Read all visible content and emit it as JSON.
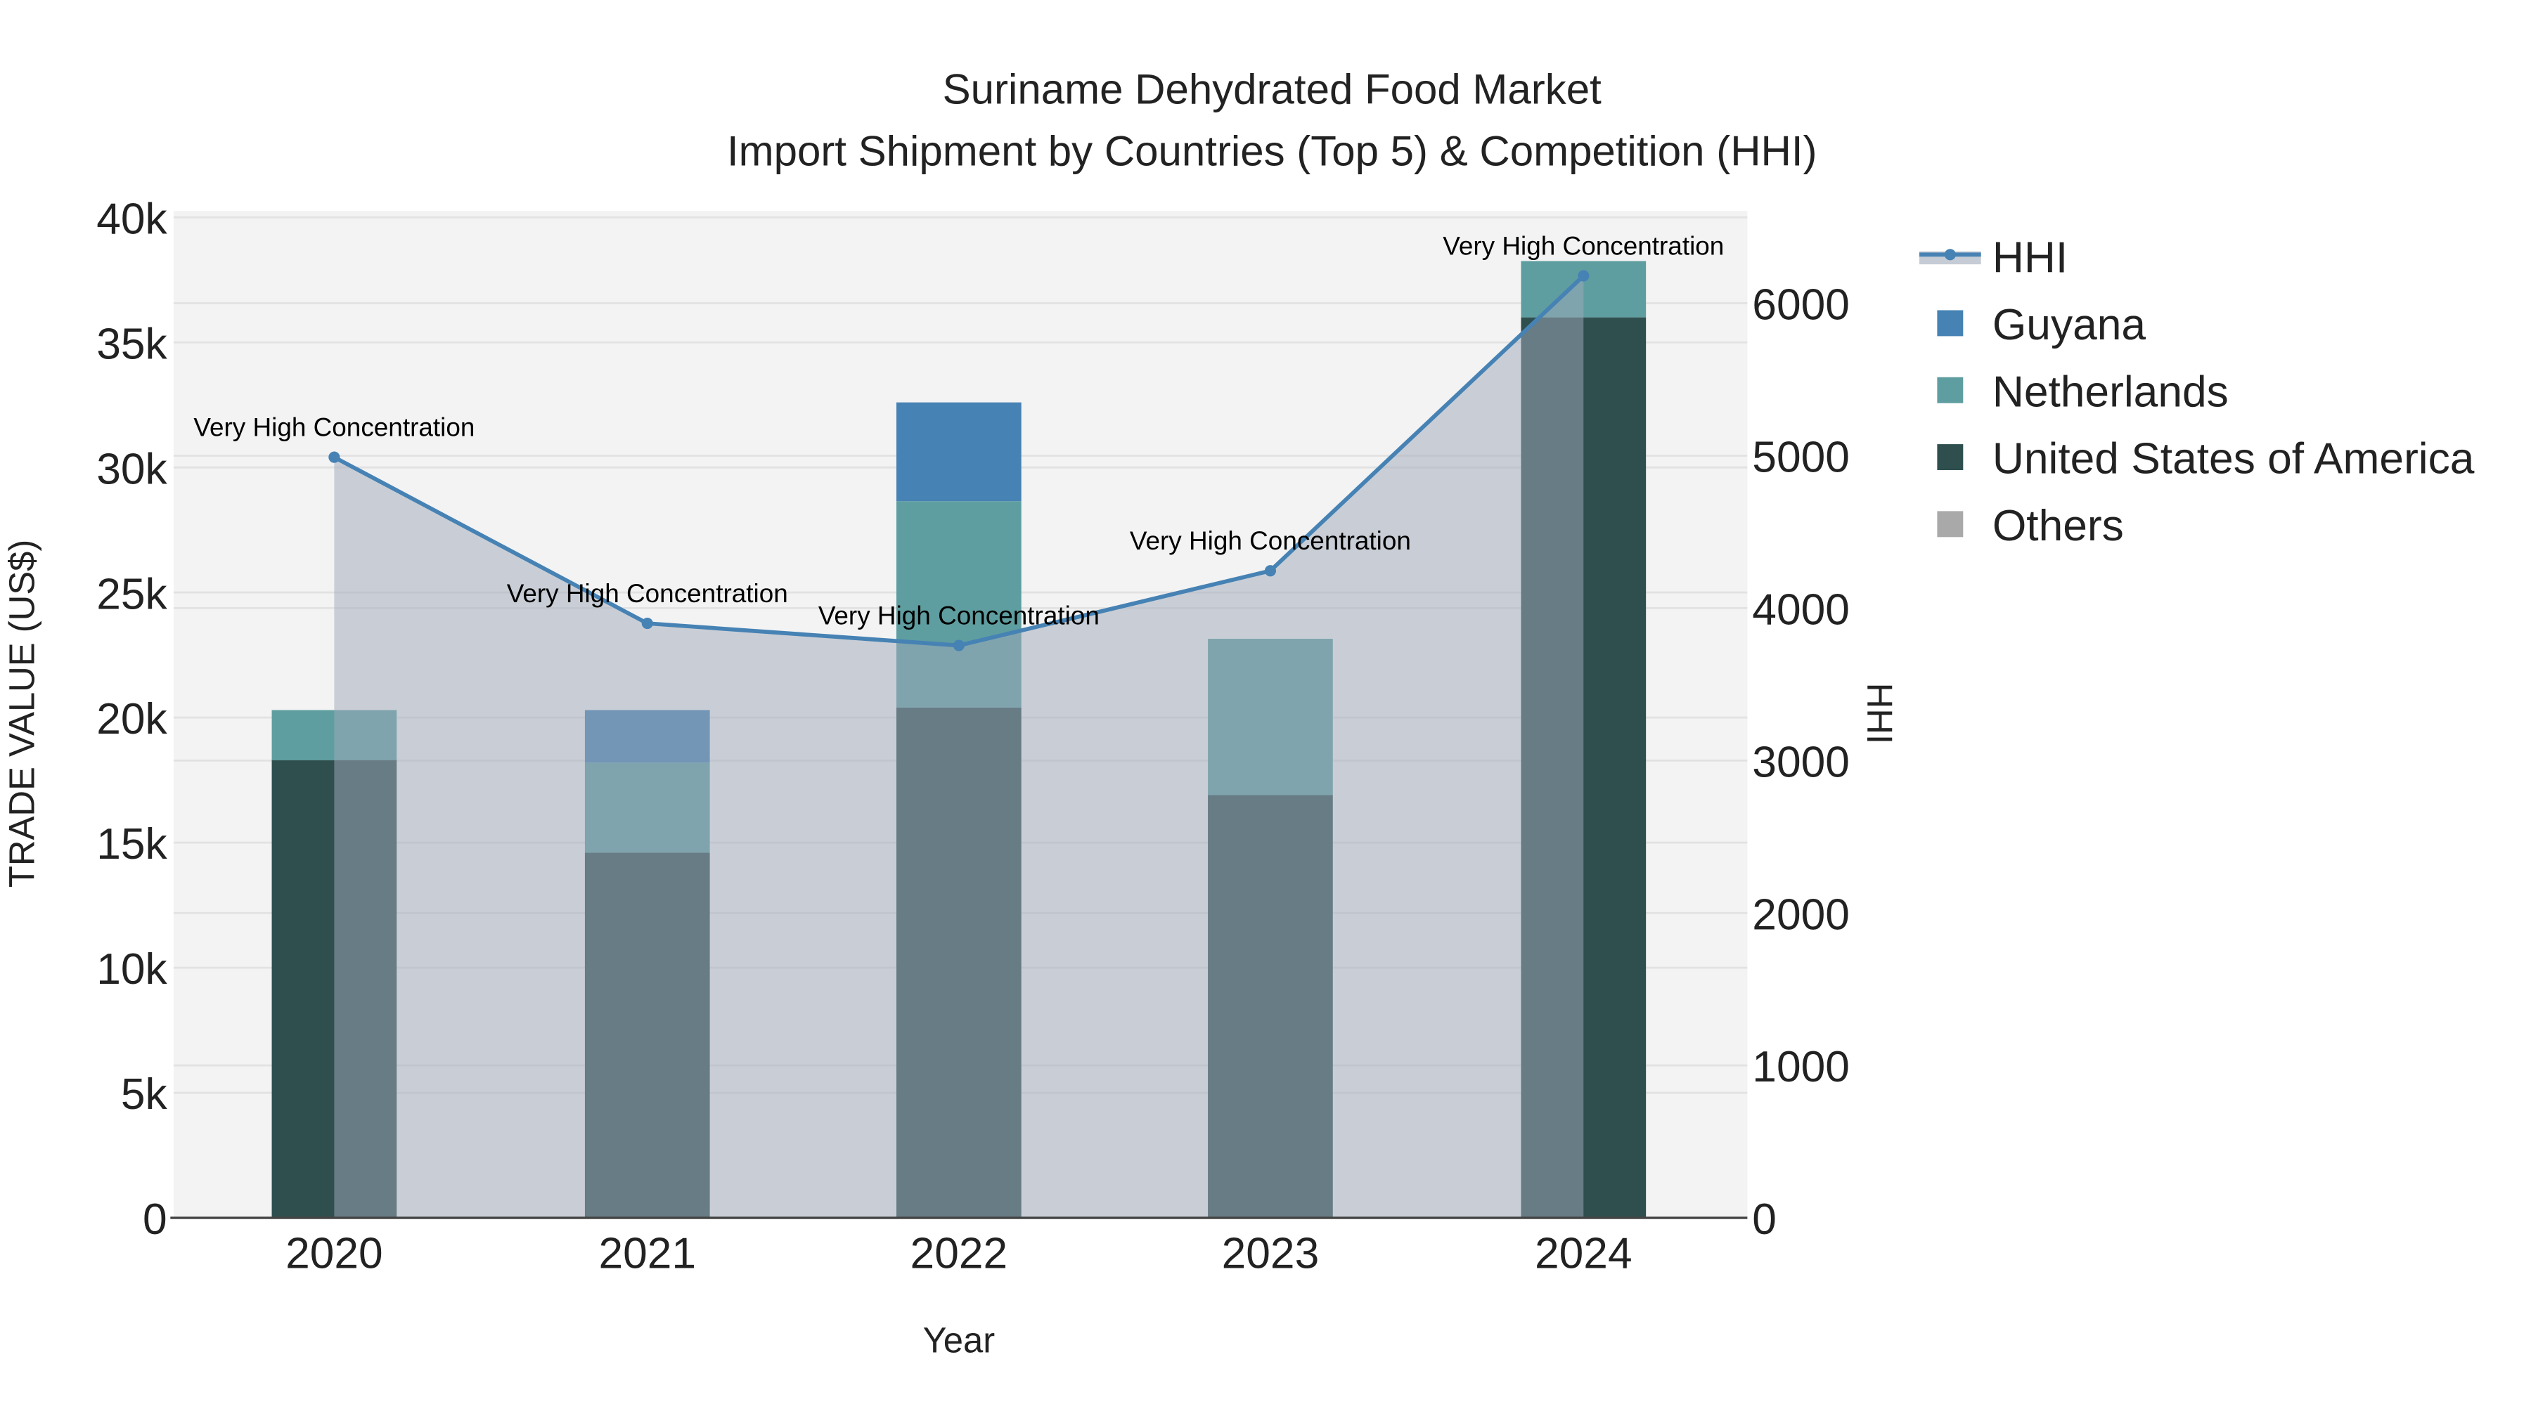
{
  "chart_data": {
    "type": "bar",
    "title": "Suriname Dehydrated Food Market",
    "subtitle": "Import Shipment by Countries (Top 5) & Competition (HHI)",
    "xlabel": "Year",
    "ylabel": "TRADE VALUE (US$)",
    "y2label": "HHI",
    "categories": [
      "2020",
      "2021",
      "2022",
      "2023",
      "2024"
    ],
    "ylim": [
      0,
      40000
    ],
    "y2lim": [
      0,
      6560
    ],
    "yticks": [
      {
        "v": 0,
        "label": "0"
      },
      {
        "v": 5000,
        "label": "5k"
      },
      {
        "v": 10000,
        "label": "10k"
      },
      {
        "v": 15000,
        "label": "15k"
      },
      {
        "v": 20000,
        "label": "20k"
      },
      {
        "v": 25000,
        "label": "25k"
      },
      {
        "v": 30000,
        "label": "30k"
      },
      {
        "v": 35000,
        "label": "35k"
      },
      {
        "v": 40000,
        "label": "40k"
      }
    ],
    "y2ticks": [
      {
        "v": 0,
        "label": "0"
      },
      {
        "v": 1000,
        "label": "1000"
      },
      {
        "v": 2000,
        "label": "2000"
      },
      {
        "v": 3000,
        "label": "3000"
      },
      {
        "v": 4000,
        "label": "4000"
      },
      {
        "v": 5000,
        "label": "5000"
      },
      {
        "v": 6000,
        "label": "6000"
      }
    ],
    "series": [
      {
        "name": "United States of America",
        "color": "#2F4F4F",
        "values": [
          18300,
          14600,
          20400,
          16900,
          36000
        ]
      },
      {
        "name": "Netherlands",
        "color": "#5F9EA0",
        "values": [
          2000,
          3600,
          8250,
          6250,
          2250
        ]
      },
      {
        "name": "Guyana",
        "color": "#4682B4",
        "values": [
          0,
          2100,
          3950,
          0,
          0
        ]
      },
      {
        "name": "Others",
        "color": "#A9A9A9",
        "values": [
          0,
          0,
          0,
          0,
          0
        ]
      }
    ],
    "hhi": {
      "name": "HHI",
      "color": "#4682B4",
      "values": [
        4990,
        3900,
        3755,
        4245,
        6180
      ],
      "annotations": [
        "Very High Concentration",
        "Very High Concentration",
        "Very High Concentration",
        "Very High Concentration",
        "Very High Concentration"
      ]
    },
    "legend": [
      "HHI",
      "Guyana",
      "Netherlands",
      "United States of America",
      "Others"
    ],
    "legend_position": "right",
    "grid": true
  }
}
